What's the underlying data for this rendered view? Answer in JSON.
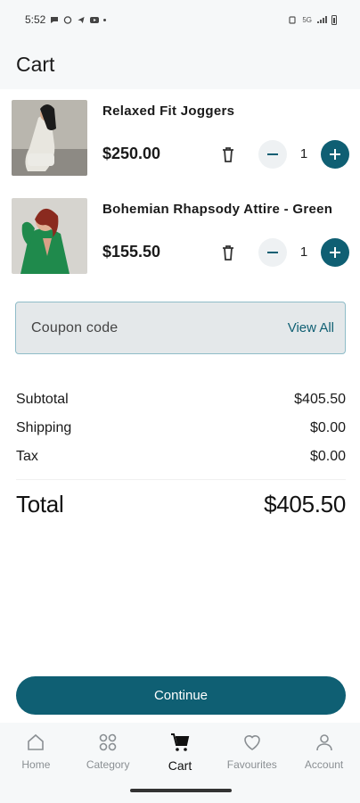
{
  "status_bar": {
    "time": "5:52",
    "network_label": "5G"
  },
  "app_bar": {
    "title": "Cart"
  },
  "cart_items": [
    {
      "name": "Relaxed Fit Joggers",
      "price": "$250.00",
      "quantity": "1"
    },
    {
      "name": "Bohemian Rhapsody Attire - Green",
      "price": "$155.50",
      "quantity": "1"
    }
  ],
  "coupon": {
    "placeholder": "Coupon code",
    "action_label": "View All"
  },
  "summary": {
    "subtotal_label": "Subtotal",
    "subtotal_value": "$405.50",
    "shipping_label": "Shipping",
    "shipping_value": "$0.00",
    "tax_label": "Tax",
    "tax_value": "$0.00",
    "total_label": "Total",
    "total_value": "$405.50"
  },
  "continue_label": "Continue",
  "nav": [
    {
      "label": "Home",
      "icon": "home-icon"
    },
    {
      "label": "Category",
      "icon": "category-icon"
    },
    {
      "label": "Cart",
      "icon": "cart-icon"
    },
    {
      "label": "Favourites",
      "icon": "heart-icon"
    },
    {
      "label": "Account",
      "icon": "account-icon"
    }
  ],
  "colors": {
    "accent": "#0f5f73",
    "background": "#f6f8f9",
    "coupon_bg": "#e4e8ea"
  }
}
